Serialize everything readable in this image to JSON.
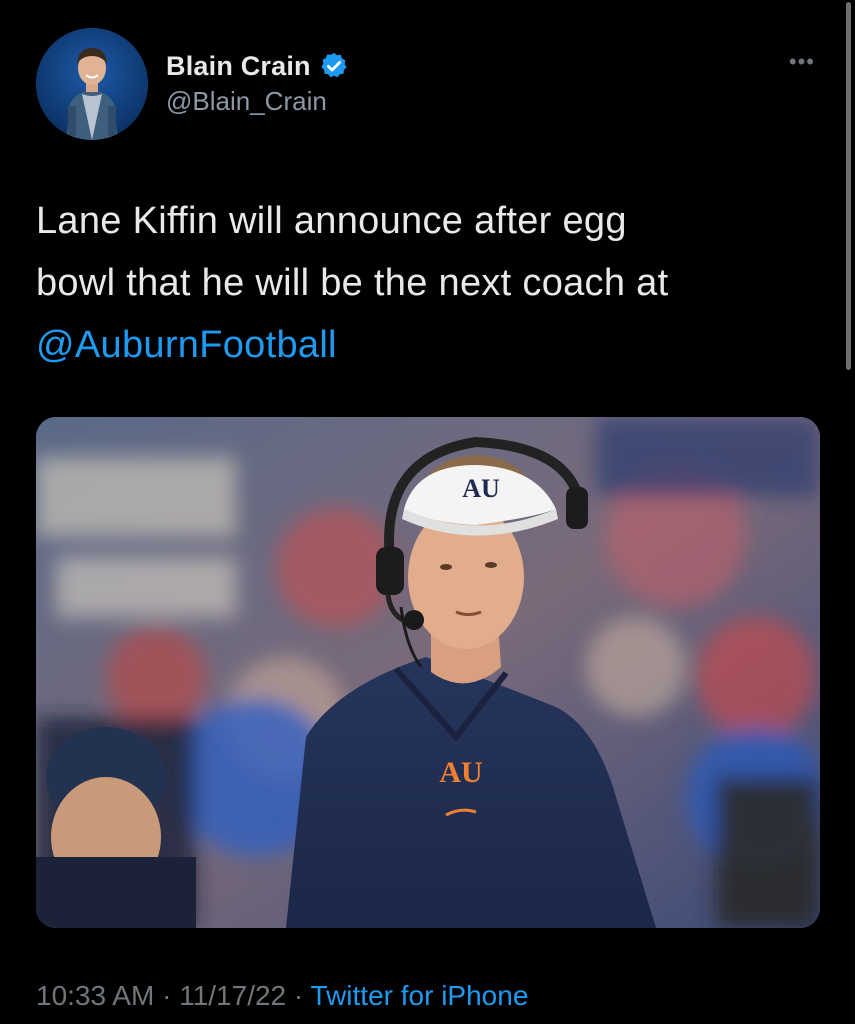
{
  "author": {
    "display_name": "Blain Crain",
    "handle": "@Blain_Crain",
    "verified": true,
    "avatar_icon": "profile-photo"
  },
  "tweet": {
    "text_line1": "Lane Kiffin will announce after egg",
    "text_line2": "bowl that he will be the next coach at",
    "mention": "@AuburnFootball",
    "media_description": "photo"
  },
  "meta": {
    "time": "10:33 AM",
    "separator1": " · ",
    "date": "11/17/22",
    "separator2": " · ",
    "source": "Twitter for iPhone"
  },
  "more_icon": "more-options-icon",
  "colors": {
    "background": "#000000",
    "text": "#e7e9ea",
    "secondary": "#71767b",
    "accent": "#1d9bf0"
  }
}
